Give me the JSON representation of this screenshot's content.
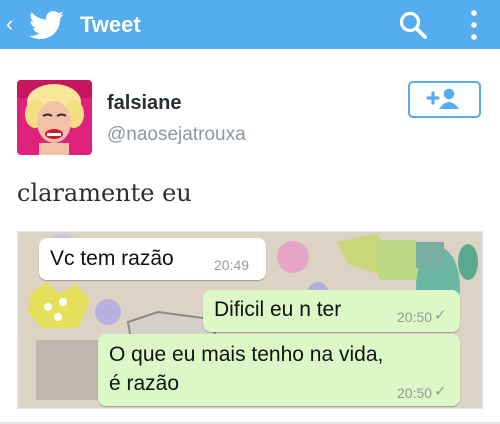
{
  "colors": {
    "accent": "#55acee",
    "incoming_bubble": "#ffffff",
    "outgoing_bubble": "#dcf8c6"
  },
  "topbar": {
    "back_icon": "chevron-left-icon",
    "logo_icon": "twitter-bird-icon",
    "title": "Tweet",
    "search_icon": "search-icon",
    "overflow_icon": "overflow-menu-icon"
  },
  "tweet": {
    "display_name": "falsiane",
    "username": "@naosejatrouxa",
    "follow_icon": "add-user-icon",
    "text": "claramente eu"
  },
  "media": {
    "messages": [
      {
        "direction": "incoming",
        "text": "Vc tem razão",
        "time": "20:49"
      },
      {
        "direction": "outgoing",
        "text": "Dificil eu n ter",
        "time": "20:50",
        "status": "✓"
      },
      {
        "direction": "outgoing",
        "lines": [
          "O que eu mais tenho na vida,",
          "é razão"
        ],
        "time": "20:50",
        "status": "✓"
      }
    ]
  }
}
